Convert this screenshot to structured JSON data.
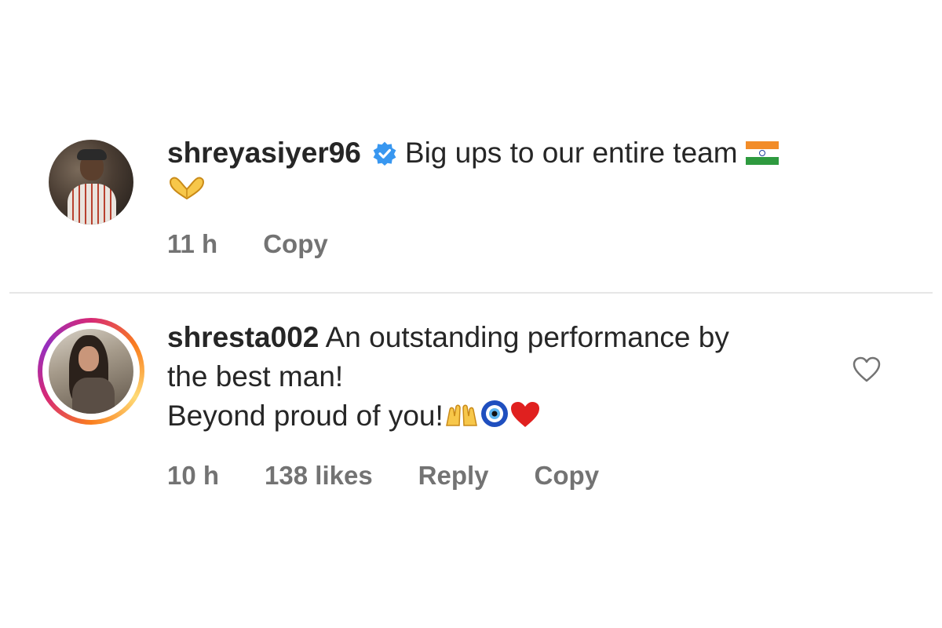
{
  "comments": [
    {
      "username": "shreyasiyer96",
      "verified": true,
      "text": "Big ups to our entire team",
      "emoji_after": "🇮🇳🫶",
      "time": "11 h",
      "copy_label": "Copy"
    },
    {
      "username": "shresta002",
      "verified": false,
      "text_line1": "An outstanding performance by",
      "text_line2": "the best man!",
      "text_line3": "Beyond proud of you!",
      "emoji_after": "🙌🧿❤️",
      "time": "10 h",
      "likes": "138 likes",
      "reply_label": "Reply",
      "copy_label": "Copy",
      "like_icon": "heart-outline-icon"
    }
  ],
  "colors": {
    "text": "#262626",
    "meta": "#737373",
    "verified": "#3897f0",
    "divider": "#e6e6e6"
  }
}
